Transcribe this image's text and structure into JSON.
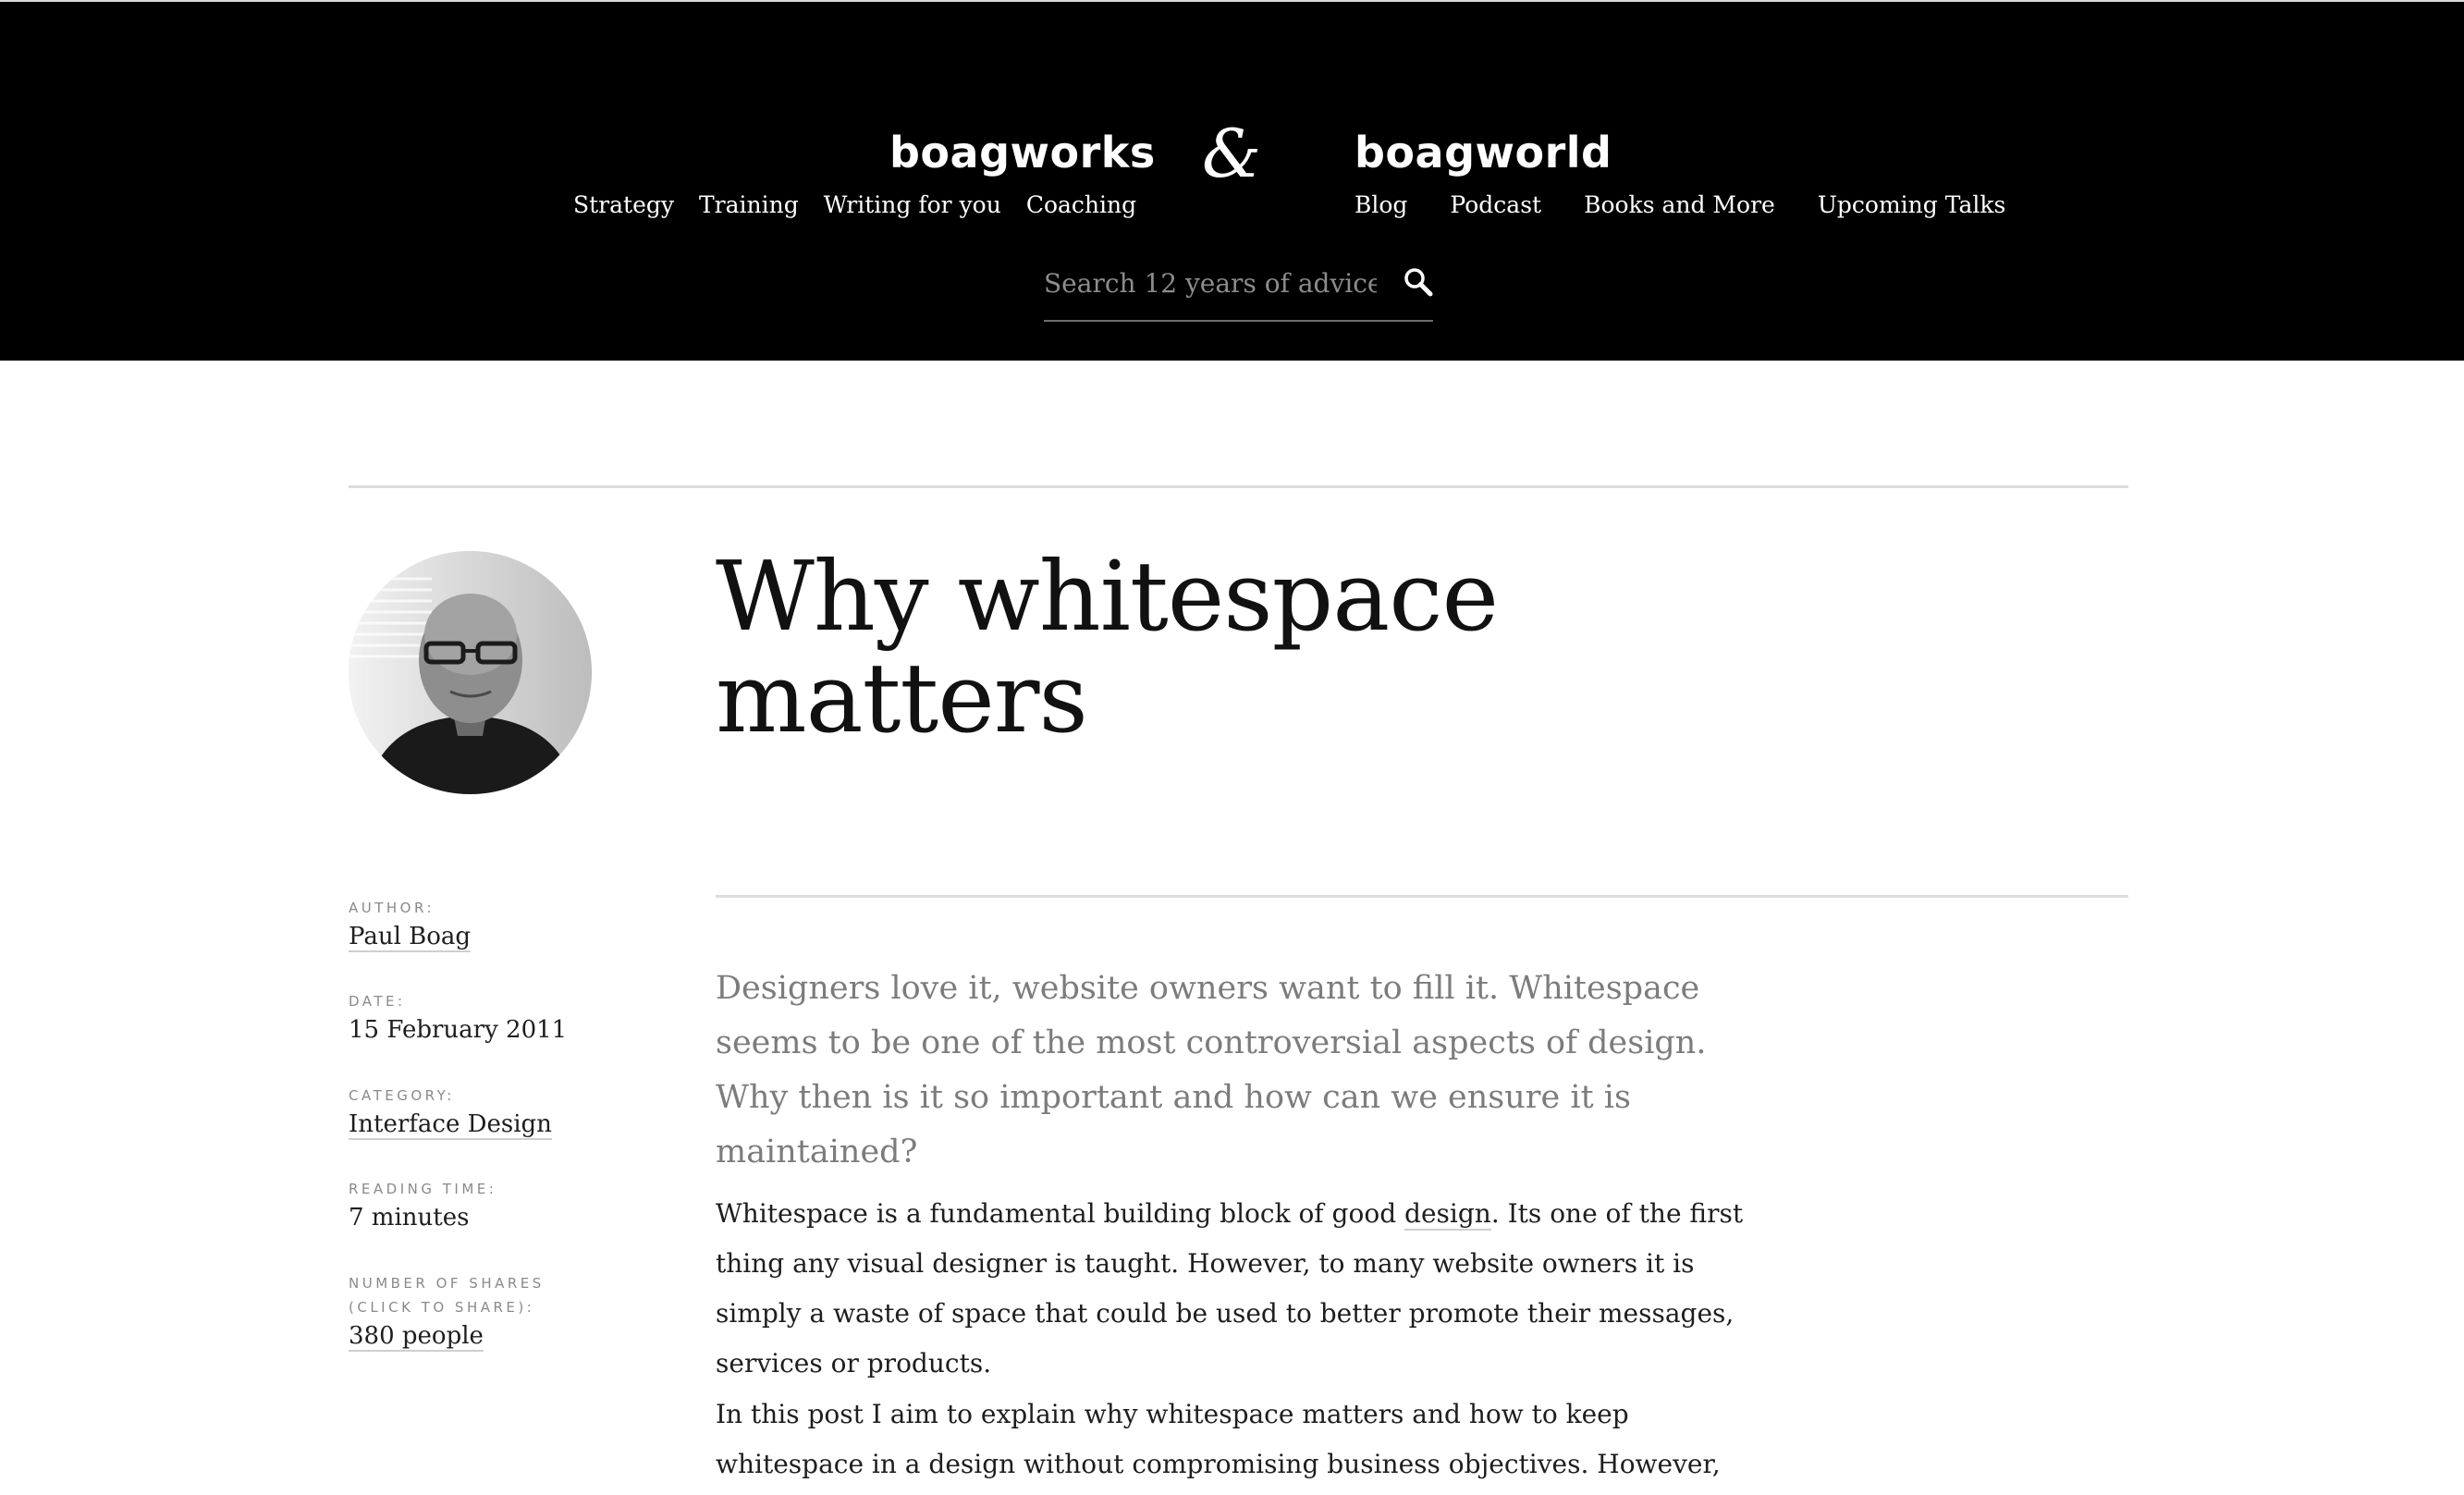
{
  "header": {
    "brand_left": "boagworks",
    "ampersand": "&",
    "brand_right": "boagworld",
    "nav_left": [
      "Strategy",
      "Training",
      "Writing for you",
      "Coaching"
    ],
    "nav_right": [
      "Blog",
      "Podcast",
      "Books and More",
      "Upcoming Talks"
    ],
    "search": {
      "placeholder": "Search 12 years of advice",
      "icon": "search-icon"
    }
  },
  "article": {
    "title_line1": "Why whitespace",
    "title_line2": "matters",
    "author_photo": "Paul Boag portrait",
    "meta": {
      "author_label": "AUTHOR:",
      "author": "Paul Boag",
      "date_label": "DATE:",
      "date": "15 February 2011",
      "category_label": "CATEGORY:",
      "category": "Interface Design",
      "reading_label": "READING TIME:",
      "reading": "7 minutes",
      "shares_label_1": "NUMBER OF SHARES",
      "shares_label_2": "(CLICK TO SHARE):",
      "shares": "380 people"
    },
    "intro": "Designers love it, website owners want to fill it. Whitespace seems to be one of the most controversial aspects of design. Why then is it so important and how can we ensure it is maintained?",
    "para1_before": "Whitespace is a fundamental building block of good ",
    "para1_link": "design",
    "para1_after": ". Its one of the first thing any visual designer is taught. However, to many website owners it is simply a waste of space that could be used to better promote their messages, services or products.",
    "para2": "In this post I aim to explain why whitespace matters and how to keep whitespace in a design without compromising business objectives. However, before I can do that"
  }
}
